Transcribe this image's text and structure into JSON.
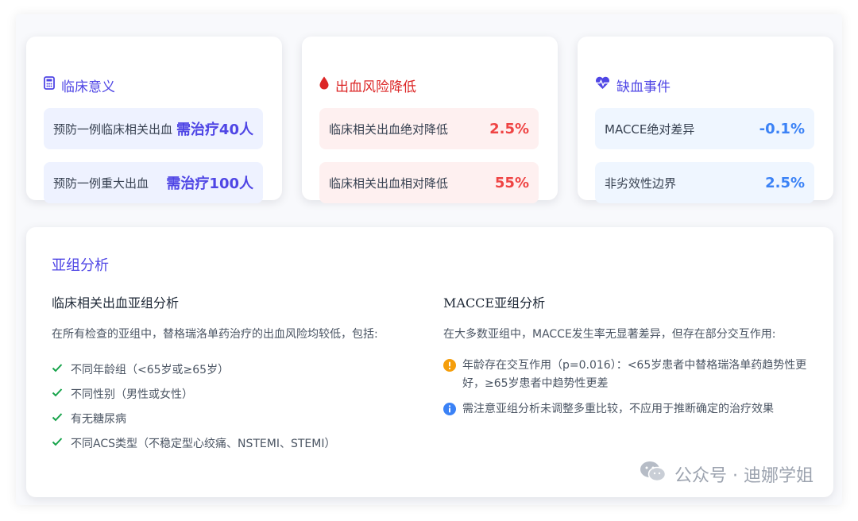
{
  "cards": [
    {
      "title": "临床意义",
      "icon": "calculator-icon",
      "rows": [
        {
          "label": "预防一例临床相关出血",
          "value": "需治疗40人"
        },
        {
          "label": "预防一例重大出血",
          "value": "需治疗100人"
        }
      ]
    },
    {
      "title": "出血风险降低",
      "icon": "blood-drop-icon",
      "rows": [
        {
          "label": "临床相关出血绝对降低",
          "value": "2.5%"
        },
        {
          "label": "临床相关出血相对降低",
          "value": "55%"
        }
      ]
    },
    {
      "title": "缺血事件",
      "icon": "heartbeat-icon",
      "rows": [
        {
          "label": "MACCE绝对差异",
          "value": "-0.1%"
        },
        {
          "label": "非劣效性边界",
          "value": "2.5%"
        }
      ]
    }
  ],
  "subgroup": {
    "title": "亚组分析",
    "bleeding": {
      "heading": "临床相关出血亚组分析",
      "desc": "在所有检查的亚组中，替格瑞洛单药治疗的出血风险均较低，包括:",
      "items": [
        "不同年龄组（<65岁或≥65岁）",
        "不同性别（男性或女性）",
        "有无糖尿病",
        "不同ACS类型（不稳定型心绞痛、NSTEMI、STEMI）"
      ]
    },
    "macce": {
      "heading": "MACCE亚组分析",
      "desc": "在大多数亚组中，MACCE发生率无显著差异，但存在部分交互作用:",
      "notes": [
        {
          "icon": "warning-icon",
          "text": "年龄存在交互作用（p=0.016）：<65岁患者中替格瑞洛单药趋势性更好，≥65岁患者中趋势性更差"
        },
        {
          "icon": "info-icon",
          "text": "需注意亚组分析未调整多重比较，不应用于推断确定的治疗效果"
        }
      ]
    }
  },
  "watermark": "公众号 · 迪娜学姐",
  "colors": {
    "indigo": "#4f46e5",
    "red": "#ef4444",
    "blue": "#3b82f6",
    "green": "#16a34a",
    "warning": "#f59e0b"
  }
}
